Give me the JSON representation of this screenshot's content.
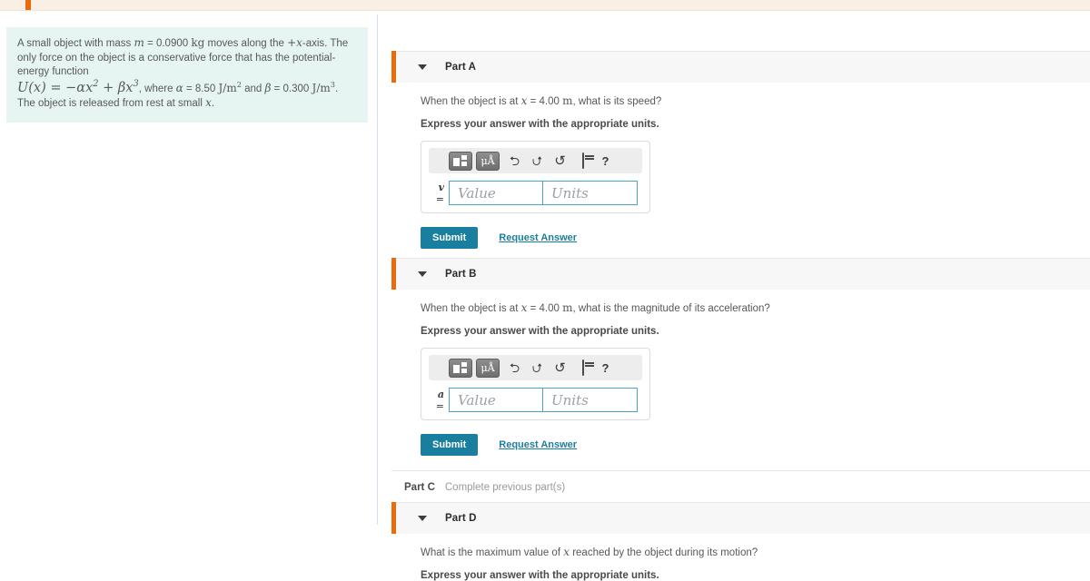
{
  "banner": {
    "tab_marker_color": "#ea6b0b",
    "background_color": "#faefe4"
  },
  "problem": {
    "line1_a": "A small object with mass ",
    "m_symbol": "m",
    "line1_b": " = 0.0900 ",
    "kg_unit": "kg",
    "line1_c": " moves along the ",
    "axis_symbol": "+x",
    "line1_d": "-axis. The only force on the object is a conservative force that has the potential-energy function",
    "equation_lhs": "U(x) = −αx² + βx³",
    "line2_a": ", where ",
    "alpha_symbol": "α",
    "line2_b": " = 8.50 ",
    "alpha_unit": "J/m²",
    "line2_c": " and ",
    "beta_symbol": "β",
    "line2_d": " = 0.300 ",
    "beta_unit": "J/m³",
    "line2_e": ". The object is released from rest at small ",
    "x_symbol": "x",
    "line2_f": "."
  },
  "toolbar": {
    "template_icon": "template-icon",
    "units_label": "μÅ",
    "undo_icon": "⮌",
    "redo_icon": "⮍",
    "reset_icon": "↺",
    "keyboard_icon": "keyboard-icon",
    "help_label": "?"
  },
  "common": {
    "express_units": "Express your answer with the appropriate units.",
    "submit_label": "Submit",
    "request_answer_label": "Request Answer",
    "value_placeholder": "Value",
    "units_placeholder": "Units",
    "caret_icon": "chevron-down-icon"
  },
  "parts": {
    "a": {
      "title": "Part A",
      "question_a": "When the object is at ",
      "question_x": "x",
      "question_b": " = 4.00 ",
      "question_unit": "m",
      "question_c": ", what is its speed?",
      "variable": "v",
      "equals": " ="
    },
    "b": {
      "title": "Part B",
      "question_a": "When the object is at ",
      "question_x": "x",
      "question_b": " = 4.00 ",
      "question_unit": "m",
      "question_c": ", what is the magnitude of its acceleration?",
      "variable": "a",
      "equals": " ="
    },
    "c": {
      "title": "Part C",
      "status": "Complete previous part(s)"
    },
    "d": {
      "title": "Part D",
      "question_a": "What is the maximum value of ",
      "question_x": "x",
      "question_b": " reached by the object during its motion?"
    }
  },
  "colors": {
    "accent_orange": "#ea6b0b",
    "teal_button": "#1a7f9e",
    "problem_box": "#e6f4f2",
    "field_border": "#4da3c4"
  }
}
